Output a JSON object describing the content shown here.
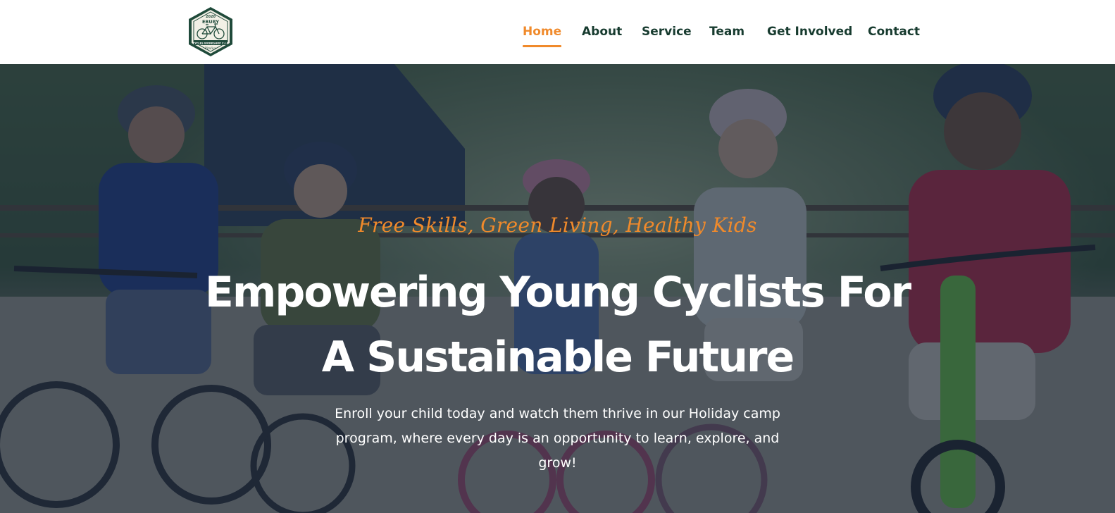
{
  "brand": {
    "logo_year": "2020",
    "logo_name": "EBURY",
    "logo_line": "CYCLES WORKSHOP C.I.C",
    "logo_script": "Pimlico",
    "colors": {
      "accent": "#f08a2b",
      "nav_text": "#173b2f",
      "logo_green": "#1f4a3a"
    }
  },
  "nav": {
    "items": [
      {
        "label": "Home",
        "active": true
      },
      {
        "label": "About",
        "active": false
      },
      {
        "label": "Service",
        "active": false
      },
      {
        "label": "Team",
        "active": false
      },
      {
        "label": "Get Involved",
        "active": false
      },
      {
        "label": "Contact",
        "active": false
      }
    ]
  },
  "hero": {
    "tagline": "Free Skills, Green Living, Healthy Kids",
    "title_line1": "Empowering Young Cyclists For",
    "title_line2": "A Sustainable Future",
    "description": "Enroll your child today and watch them thrive in our Holiday camp program, where every day is an opportunity to learn, explore, and grow!",
    "background": "photo of children sitting on bicycles wearing helmets",
    "overlay_color": "#18263e"
  }
}
